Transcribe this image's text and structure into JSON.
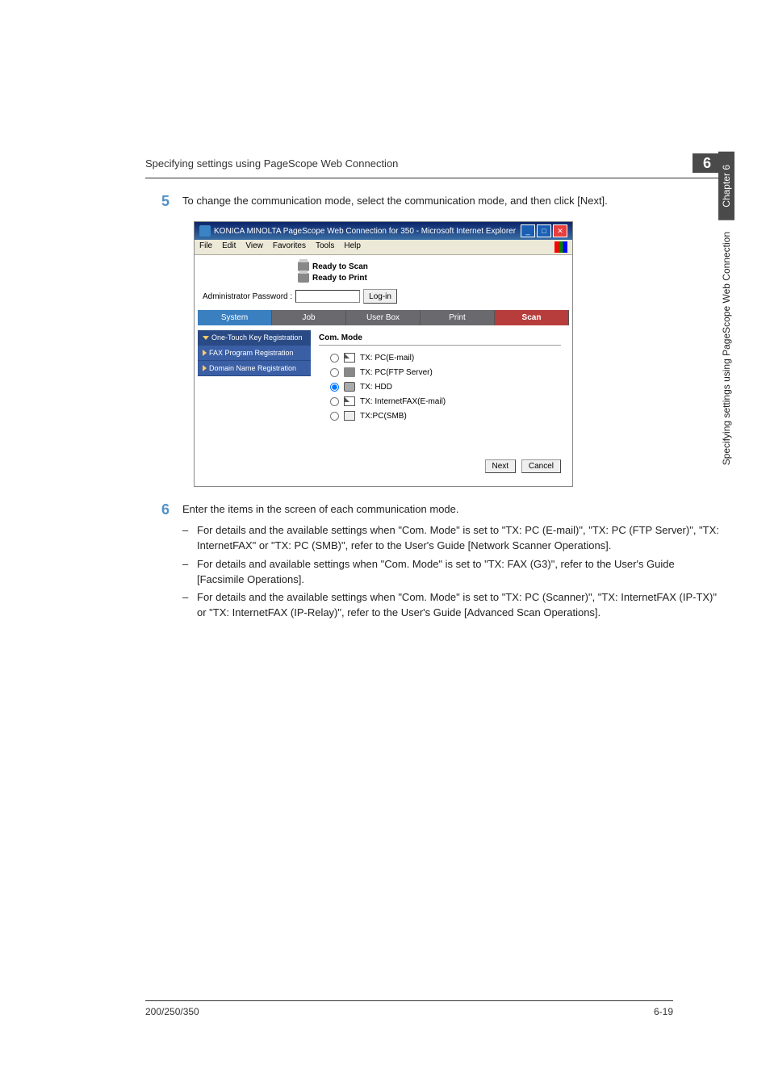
{
  "header": {
    "breadcrumb": "Specifying settings using PageScope Web Connection",
    "chapter_num": "6"
  },
  "side_tab": {
    "chapter": "Chapter 6",
    "title": "Specifying settings using PageScope Web Connection"
  },
  "step5": {
    "num": "5",
    "text": "To change the communication mode, select the communication mode, and then click [Next]."
  },
  "screenshot": {
    "title": "KONICA MINOLTA PageScope Web Connection for 350 - Microsoft Internet Explorer",
    "menu": {
      "file": "File",
      "edit": "Edit",
      "view": "View",
      "favorites": "Favorites",
      "tools": "Tools",
      "help": "Help"
    },
    "status": {
      "scan": "Ready to Scan",
      "print": "Ready to Print"
    },
    "admin": {
      "label": "Administrator Password :",
      "login": "Log-in"
    },
    "tabs": {
      "system": "System",
      "job": "Job",
      "userbox": "User Box",
      "print": "Print",
      "scan": "Scan"
    },
    "sidebar": {
      "onetouch": "One-Touch Key Registration",
      "faxprog": "FAX Program Registration",
      "domain": "Domain Name Registration"
    },
    "panel": {
      "head": "Com. Mode",
      "r1": "TX: PC(E-mail)",
      "r2": "TX: PC(FTP Server)",
      "r3": "TX: HDD",
      "r4": "TX: InternetFAX(E-mail)",
      "r5": "TX:PC(SMB)"
    },
    "buttons": {
      "next": "Next",
      "cancel": "Cancel"
    }
  },
  "step6": {
    "num": "6",
    "text": "Enter the items in the screen of each communication mode.",
    "b1": "For details and the available settings when \"Com. Mode\" is set to \"TX: PC (E-mail)\", \"TX: PC (FTP Server)\", \"TX: InternetFAX\" or \"TX: PC (SMB)\", refer to the User's Guide [Network Scanner Operations].",
    "b2": "For details and available settings when \"Com. Mode\" is set to \"TX: FAX (G3)\", refer to the User's Guide [Facsimile Operations].",
    "b3": "For details and the available settings when \"Com. Mode\" is set to \"TX: PC (Scanner)\", \"TX: InternetFAX (IP-TX)\" or \"TX: InternetFAX (IP-Relay)\", refer to the User's Guide [Advanced Scan Operations]."
  },
  "footer": {
    "model": "200/250/350",
    "pagenum": "6-19"
  }
}
